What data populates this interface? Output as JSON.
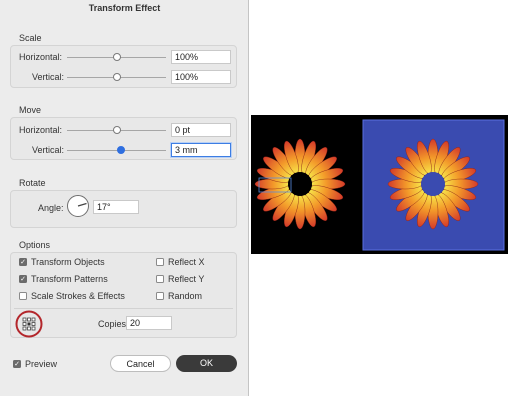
{
  "dialog": {
    "title": "Transform Effect",
    "scale": {
      "legend": "Scale",
      "horizontal_label": "Horizontal:",
      "horizontal_value": "100%",
      "vertical_label": "Vertical:",
      "vertical_value": "100%"
    },
    "move": {
      "legend": "Move",
      "horizontal_label": "Horizontal:",
      "horizontal_value": "0 pt",
      "vertical_label": "Vertical:",
      "vertical_value": "3 mm"
    },
    "rotate": {
      "legend": "Rotate",
      "angle_label": "Angle:",
      "angle_value": "17°"
    },
    "options": {
      "legend": "Options",
      "transform_objects": {
        "label": "Transform Objects",
        "checked": true
      },
      "transform_patterns": {
        "label": "Transform Patterns",
        "checked": true
      },
      "scale_strokes": {
        "label": "Scale Strokes & Effects",
        "checked": false
      },
      "reflect_x": {
        "label": "Reflect X",
        "checked": false
      },
      "reflect_y": {
        "label": "Reflect Y",
        "checked": false
      },
      "random": {
        "label": "Random",
        "checked": false
      }
    },
    "copies_label": "Copies",
    "copies_value": "20",
    "preview": {
      "label": "Preview",
      "checked": true
    },
    "cancel_label": "Cancel",
    "ok_label": "OK"
  },
  "colors": {
    "accent": "#2f6fe0",
    "ok_button": "#3a3a3a",
    "highlight_ring": "#b3262b",
    "preview_left_bg": "#000000",
    "preview_right_bg": "#3a4bb0",
    "petal_inner": "#f7e64a",
    "petal_outer": "#d43a2a"
  },
  "icons": {
    "reference_point": "reference-point-locator-icon",
    "angle_dial": "angle-dial-icon",
    "check": "checkmark-icon"
  }
}
